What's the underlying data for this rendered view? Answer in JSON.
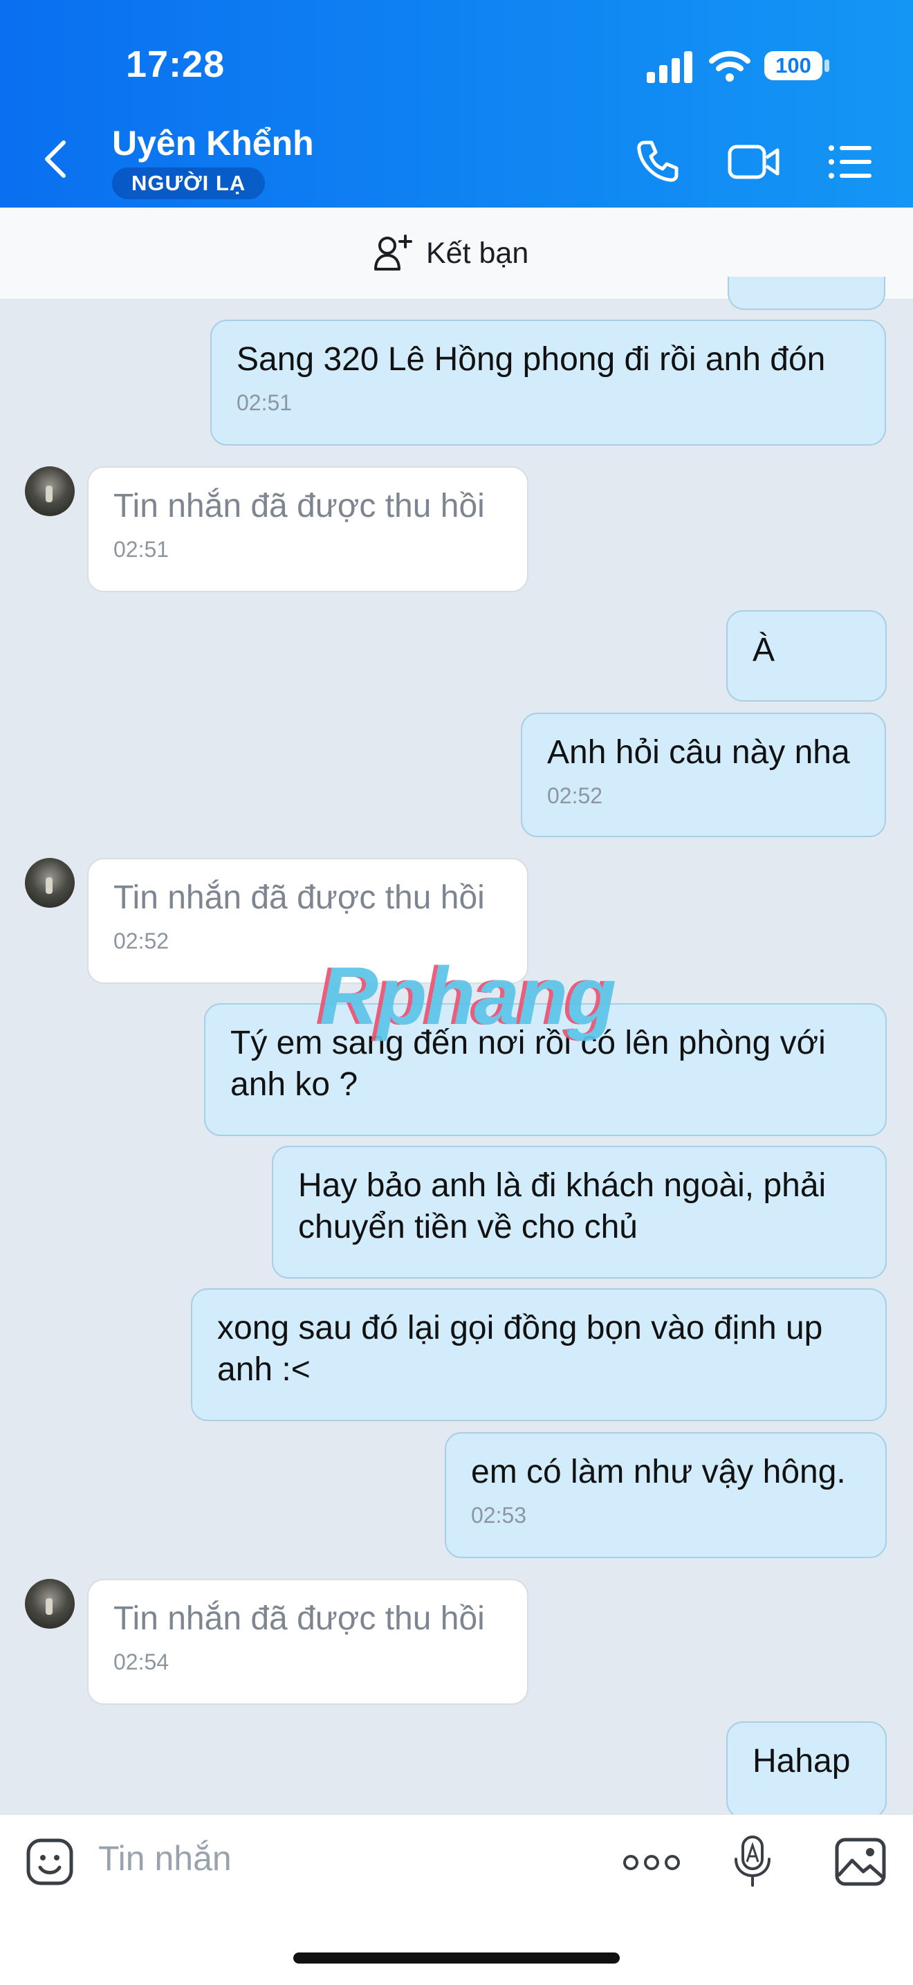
{
  "status_bar": {
    "time": "17:28",
    "battery": "100"
  },
  "header": {
    "contact_name": "Uyên Khểnh",
    "badge": "NGƯỜI LẠ"
  },
  "add_friend": {
    "label": "Kết bạn"
  },
  "watermark": "Rphang",
  "messages": [
    {
      "side": "sent",
      "text": "Sang 320 Lê Hồng phong đi rồi anh đón",
      "time": "02:51"
    },
    {
      "side": "received",
      "text": "Tin nhắn đã được thu hồi",
      "time": "02:51"
    },
    {
      "side": "sent",
      "text": "À",
      "time": ""
    },
    {
      "side": "sent",
      "text": "Anh hỏi câu này nha",
      "time": "02:52"
    },
    {
      "side": "received",
      "text": "Tin nhắn đã được thu hồi",
      "time": "02:52"
    },
    {
      "side": "sent",
      "text": "Tý em sang đến nơi rồi có lên phòng với\nanh ko ?",
      "time": ""
    },
    {
      "side": "sent",
      "text": "Hay bảo anh là đi khách ngoài, phải\nchuyển tiền về cho chủ",
      "time": ""
    },
    {
      "side": "sent",
      "text": "xong sau đó lại gọi đồng bọn vào định up\nanh :<",
      "time": ""
    },
    {
      "side": "sent",
      "text": "em có làm như vậy hông.",
      "time": "02:53"
    },
    {
      "side": "received",
      "text": "Tin nhắn đã được thu hồi",
      "time": "02:54"
    },
    {
      "side": "sent",
      "text": "Hahap",
      "time": ""
    }
  ],
  "composer": {
    "placeholder": "Tin nhắn"
  },
  "colors": {
    "header_start": "#0a6ff0",
    "header_end": "#1496f5",
    "sent_bubble": "#d2ecfb",
    "received_bubble": "#ffffff",
    "chat_background": "#e2e9f1"
  },
  "icons": [
    "back-icon",
    "phone-icon",
    "video-call-icon",
    "menu-list-icon",
    "add-friend-icon",
    "sticker-icon",
    "more-icon",
    "voice-icon",
    "image-icon"
  ]
}
